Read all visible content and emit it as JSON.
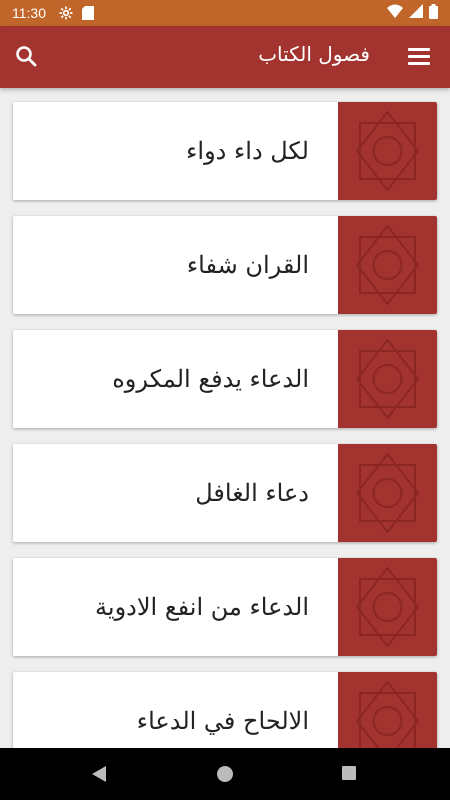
{
  "status": {
    "time": "11:30"
  },
  "appbar": {
    "title": "فصول الكتاب"
  },
  "chapters": [
    {
      "title": "لكل داء دواء"
    },
    {
      "title": "القران شفاء"
    },
    {
      "title": "الدعاء يدفع المكروه"
    },
    {
      "title": "دعاء الغافل"
    },
    {
      "title": "الدعاء من انفع الادوية"
    },
    {
      "title": "الالحاح في الدعاء"
    }
  ],
  "colors": {
    "statusbar": "#c0662a",
    "appbar": "#a2332f",
    "thumb": "#a2332f"
  }
}
